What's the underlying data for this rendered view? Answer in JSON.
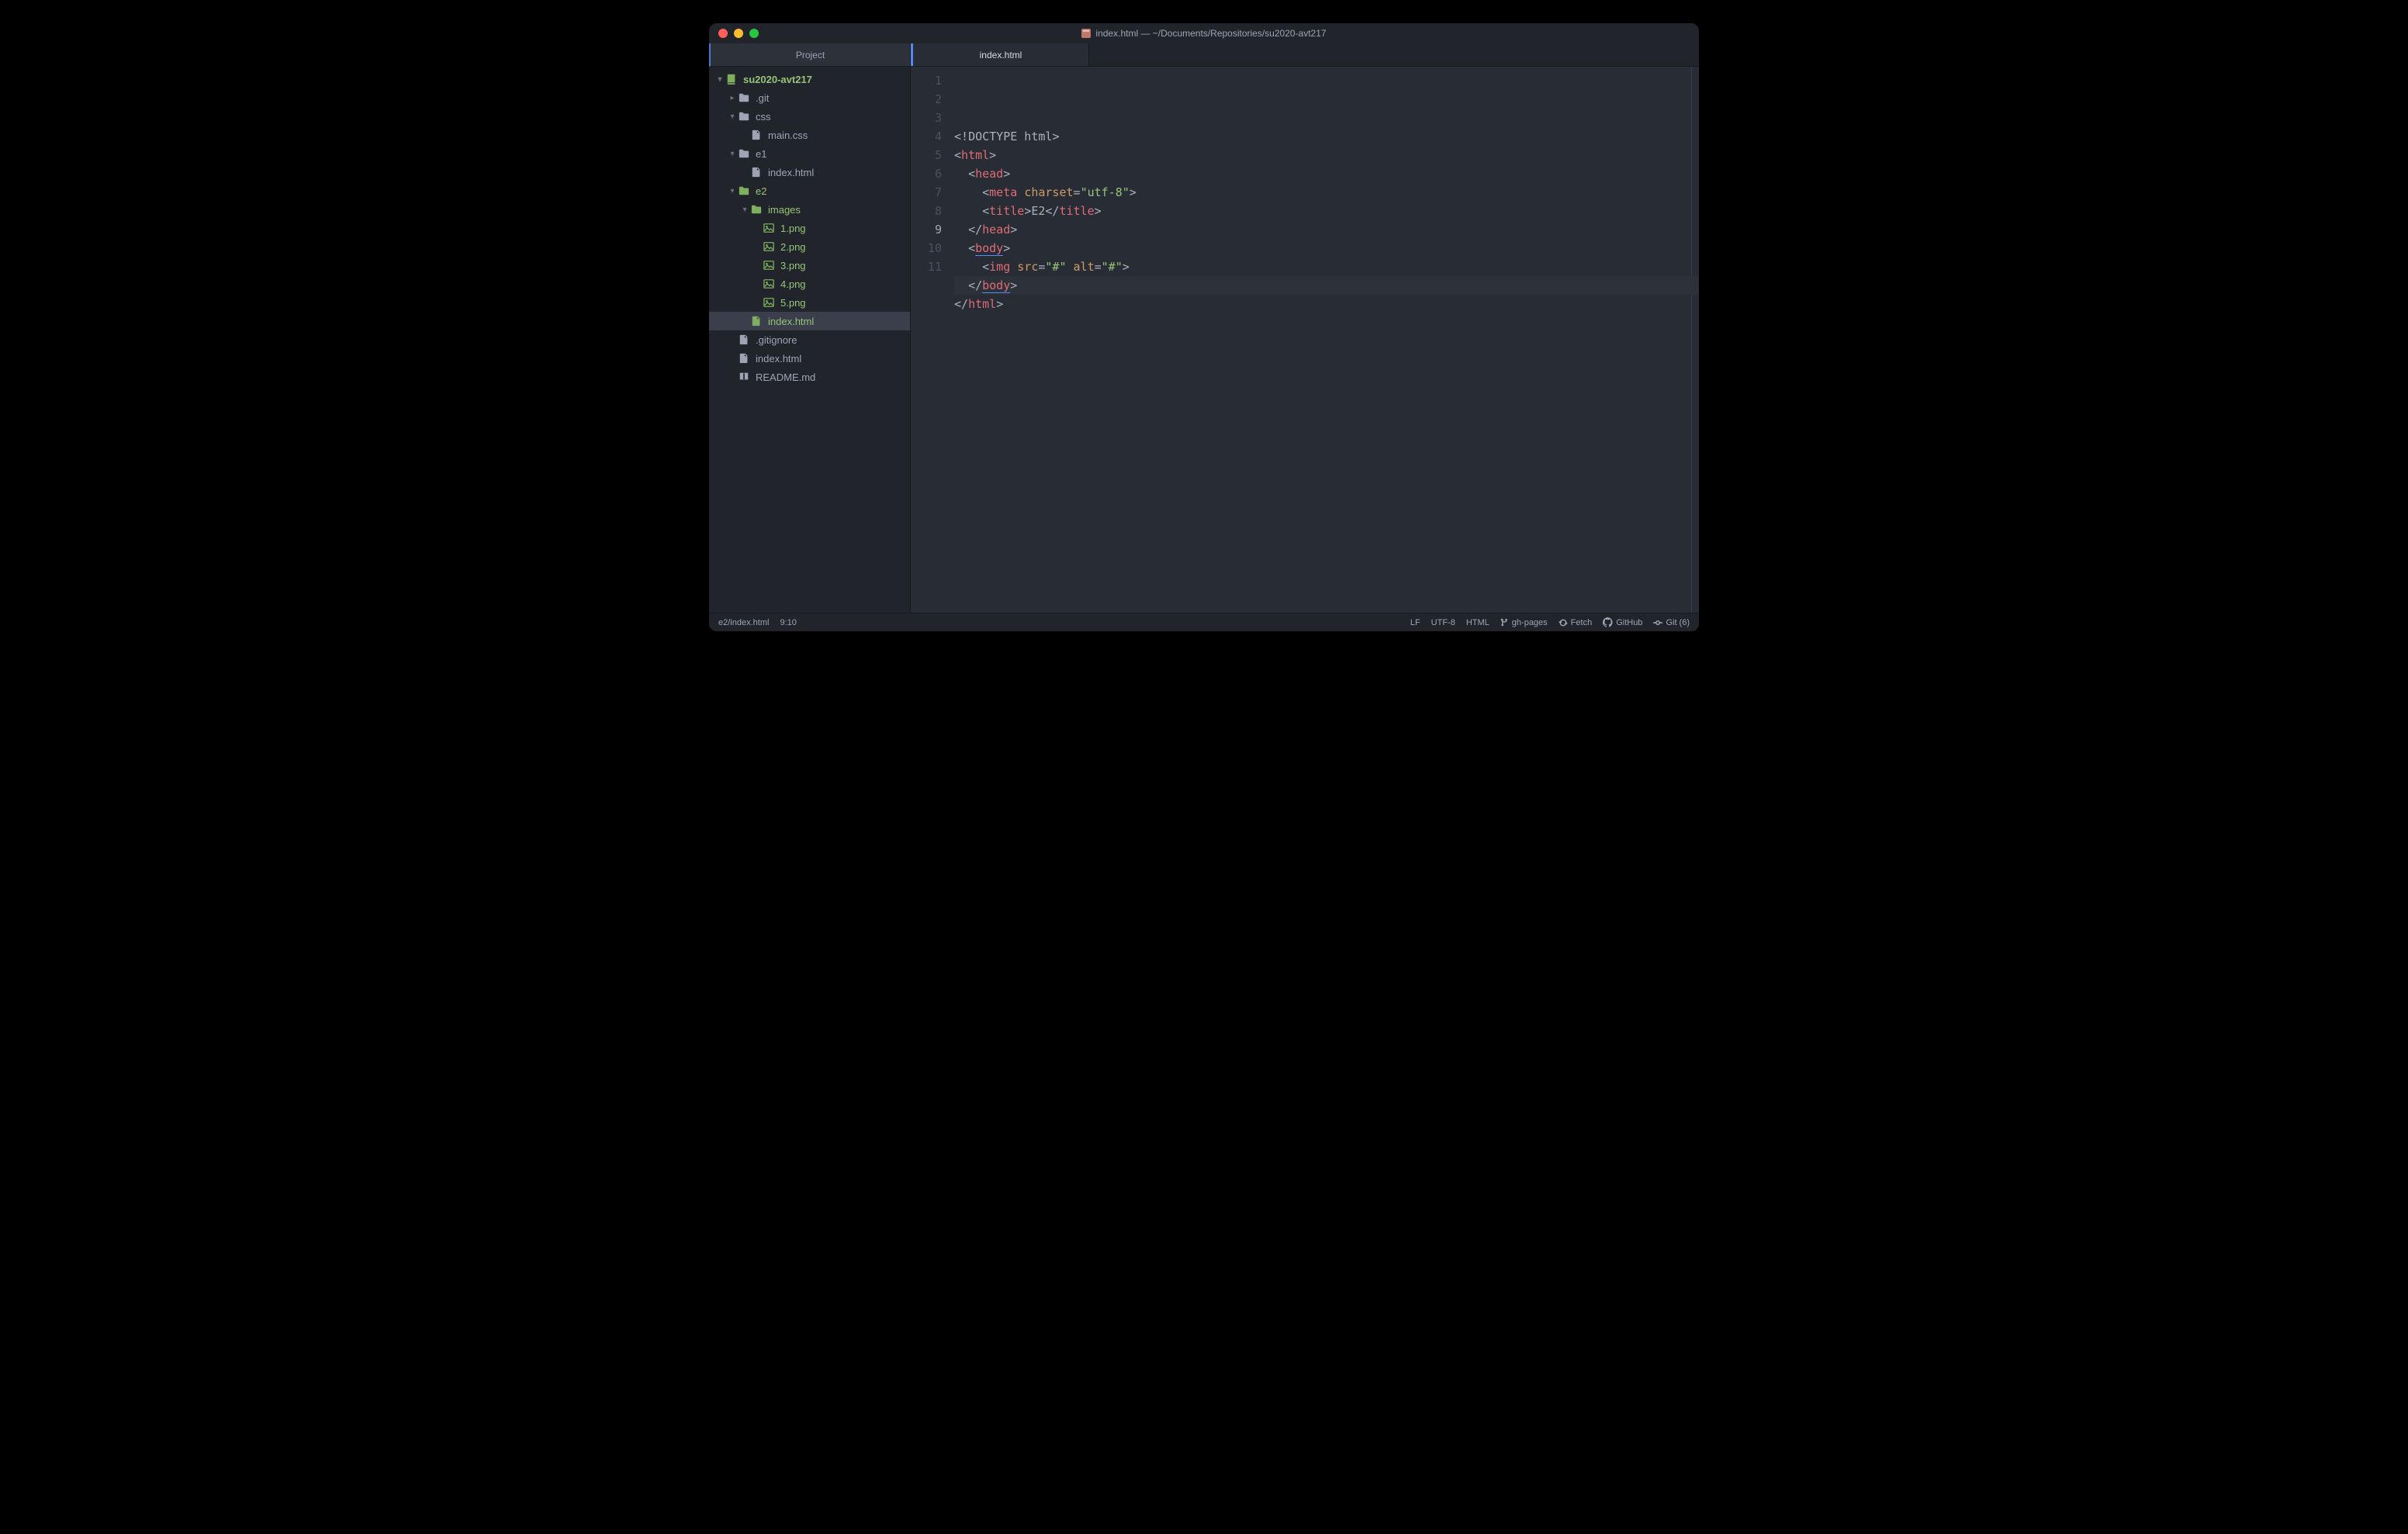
{
  "window": {
    "title": "index.html — ~/Documents/Repositories/su2020-avt217"
  },
  "sidebar": {
    "tab_label": "Project",
    "root": "su2020-avt217"
  },
  "tree": [
    {
      "depth": 0,
      "chev": "▾",
      "icon": "repo",
      "label": "su2020-avt217",
      "modified": true,
      "root": true
    },
    {
      "depth": 1,
      "chev": "▸",
      "icon": "folder",
      "label": ".git",
      "modified": false
    },
    {
      "depth": 1,
      "chev": "▾",
      "icon": "folder",
      "label": "css",
      "modified": false
    },
    {
      "depth": 2,
      "chev": "",
      "icon": "file",
      "label": "main.css",
      "modified": false
    },
    {
      "depth": 1,
      "chev": "▾",
      "icon": "folder",
      "label": "e1",
      "modified": false
    },
    {
      "depth": 2,
      "chev": "",
      "icon": "file",
      "label": "index.html",
      "modified": false
    },
    {
      "depth": 1,
      "chev": "▾",
      "icon": "folder",
      "label": "e2",
      "modified": true
    },
    {
      "depth": 2,
      "chev": "▾",
      "icon": "folder",
      "label": "images",
      "modified": true
    },
    {
      "depth": 3,
      "chev": "",
      "icon": "image",
      "label": "1.png",
      "modified": true
    },
    {
      "depth": 3,
      "chev": "",
      "icon": "image",
      "label": "2.png",
      "modified": true
    },
    {
      "depth": 3,
      "chev": "",
      "icon": "image",
      "label": "3.png",
      "modified": true
    },
    {
      "depth": 3,
      "chev": "",
      "icon": "image",
      "label": "4.png",
      "modified": true
    },
    {
      "depth": 3,
      "chev": "",
      "icon": "image",
      "label": "5.png",
      "modified": true
    },
    {
      "depth": 2,
      "chev": "",
      "icon": "file",
      "label": "index.html",
      "modified": true,
      "selected": true
    },
    {
      "depth": 1,
      "chev": "",
      "icon": "file",
      "label": ".gitignore",
      "modified": false
    },
    {
      "depth": 1,
      "chev": "",
      "icon": "file",
      "label": "index.html",
      "modified": false
    },
    {
      "depth": 1,
      "chev": "",
      "icon": "book",
      "label": "README.md",
      "modified": false
    }
  ],
  "tab": {
    "label": "index.html"
  },
  "code": {
    "lines": [
      {
        "n": 1,
        "spans": [
          {
            "c": "t-bracket",
            "t": "<!"
          },
          {
            "c": "t-doctype",
            "t": "DOCTYPE html"
          },
          {
            "c": "t-bracket",
            "t": ">"
          }
        ]
      },
      {
        "n": 2,
        "spans": [
          {
            "c": "t-bracket",
            "t": "<"
          },
          {
            "c": "t-tag",
            "t": "html"
          },
          {
            "c": "t-bracket",
            "t": ">"
          }
        ]
      },
      {
        "n": 3,
        "indent": 1,
        "spans": [
          {
            "c": "t-bracket",
            "t": "<"
          },
          {
            "c": "t-tag",
            "t": "head"
          },
          {
            "c": "t-bracket",
            "t": ">"
          }
        ]
      },
      {
        "n": 4,
        "indent": 2,
        "spans": [
          {
            "c": "t-bracket",
            "t": "<"
          },
          {
            "c": "t-tag",
            "t": "meta"
          },
          {
            "c": "t-text",
            "t": " "
          },
          {
            "c": "t-attr",
            "t": "charset"
          },
          {
            "c": "t-bracket",
            "t": "="
          },
          {
            "c": "t-string",
            "t": "\"utf-8\""
          },
          {
            "c": "t-bracket",
            "t": ">"
          }
        ]
      },
      {
        "n": 5,
        "indent": 2,
        "spans": [
          {
            "c": "t-bracket",
            "t": "<"
          },
          {
            "c": "t-tag",
            "t": "title"
          },
          {
            "c": "t-bracket",
            "t": ">"
          },
          {
            "c": "t-text",
            "t": "E2"
          },
          {
            "c": "t-bracket",
            "t": "</"
          },
          {
            "c": "t-tag",
            "t": "title"
          },
          {
            "c": "t-bracket",
            "t": ">"
          }
        ]
      },
      {
        "n": 6,
        "indent": 1,
        "spans": [
          {
            "c": "t-bracket",
            "t": "</"
          },
          {
            "c": "t-tag",
            "t": "head"
          },
          {
            "c": "t-bracket",
            "t": ">"
          }
        ]
      },
      {
        "n": 7,
        "indent": 1,
        "spans": [
          {
            "c": "t-bracket",
            "t": "<"
          },
          {
            "c": "t-tag underline",
            "t": "body"
          },
          {
            "c": "t-bracket",
            "t": ">"
          }
        ]
      },
      {
        "n": 8,
        "indent": 2,
        "spans": [
          {
            "c": "t-bracket",
            "t": "<"
          },
          {
            "c": "t-tag",
            "t": "img"
          },
          {
            "c": "t-text",
            "t": " "
          },
          {
            "c": "t-attr",
            "t": "src"
          },
          {
            "c": "t-bracket",
            "t": "="
          },
          {
            "c": "t-string",
            "t": "\"#\""
          },
          {
            "c": "t-text",
            "t": " "
          },
          {
            "c": "t-attr",
            "t": "alt"
          },
          {
            "c": "t-bracket",
            "t": "="
          },
          {
            "c": "t-string",
            "t": "\"#\""
          },
          {
            "c": "t-bracket",
            "t": ">"
          }
        ]
      },
      {
        "n": 9,
        "indent": 1,
        "current": true,
        "spans": [
          {
            "c": "t-bracket",
            "t": "</"
          },
          {
            "c": "t-tag underline",
            "t": "body"
          },
          {
            "c": "t-bracket",
            "t": ">"
          }
        ]
      },
      {
        "n": 10,
        "spans": [
          {
            "c": "t-bracket",
            "t": "</"
          },
          {
            "c": "t-tag",
            "t": "html"
          },
          {
            "c": "t-bracket",
            "t": ">"
          }
        ]
      },
      {
        "n": 11,
        "spans": []
      }
    ]
  },
  "statusbar": {
    "path": "e2/index.html",
    "cursor": "9:10",
    "line_ending": "LF",
    "encoding": "UTF-8",
    "grammar": "HTML",
    "branch": "gh-pages",
    "fetch": "Fetch",
    "github": "GitHub",
    "git": "Git (6)"
  }
}
